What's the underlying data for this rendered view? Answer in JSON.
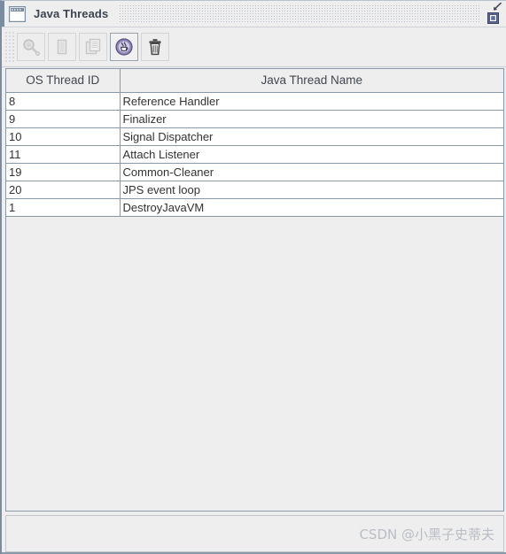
{
  "window": {
    "title": "Java Threads",
    "icon": "window-icon",
    "buttons": [
      {
        "name": "float-window-button",
        "icon": "diagonal-arrow-icon",
        "label": "Float"
      },
      {
        "name": "restore-window-button",
        "icon": "restore-window-icon",
        "label": "Restore"
      }
    ]
  },
  "toolbar": {
    "grip": "toolbar-drag-handle",
    "buttons": [
      {
        "name": "inspect-button",
        "icon": "magnifier-icon",
        "label": "Inspect",
        "state": "disabled"
      },
      {
        "name": "monitor-button",
        "icon": "memory-bar-icon",
        "label": "Monitor",
        "state": "disabled"
      },
      {
        "name": "copy-button",
        "icon": "copy-pages-icon",
        "label": "Copy",
        "state": "disabled"
      },
      {
        "name": "java-thread-button",
        "icon": "java-coffee-icon",
        "label": "Java Threads",
        "state": "active"
      },
      {
        "name": "delete-button",
        "icon": "trash-can-icon",
        "label": "Delete",
        "state": "enabled"
      }
    ]
  },
  "table": {
    "columns": [
      "OS Thread ID",
      "Java Thread Name"
    ],
    "rows": [
      {
        "os_thread_id": "8",
        "java_thread_name": "Reference Handler"
      },
      {
        "os_thread_id": "9",
        "java_thread_name": "Finalizer"
      },
      {
        "os_thread_id": "10",
        "java_thread_name": "Signal Dispatcher"
      },
      {
        "os_thread_id": "11",
        "java_thread_name": "Attach Listener"
      },
      {
        "os_thread_id": "19",
        "java_thread_name": "Common-Cleaner"
      },
      {
        "os_thread_id": "20",
        "java_thread_name": "JPS event loop"
      },
      {
        "os_thread_id": "1",
        "java_thread_name": "DestroyJavaVM"
      }
    ]
  },
  "bottom": {
    "watermark": "CSDN @小黑子史蒂夫"
  },
  "colors": {
    "frame_border": "#8a99a8",
    "panel_bg": "#eeeeee",
    "row_bg": "#ffffff",
    "title_text": "#3d4450",
    "watermark": "#b9bec4",
    "java_icon": "#8b84b8"
  }
}
